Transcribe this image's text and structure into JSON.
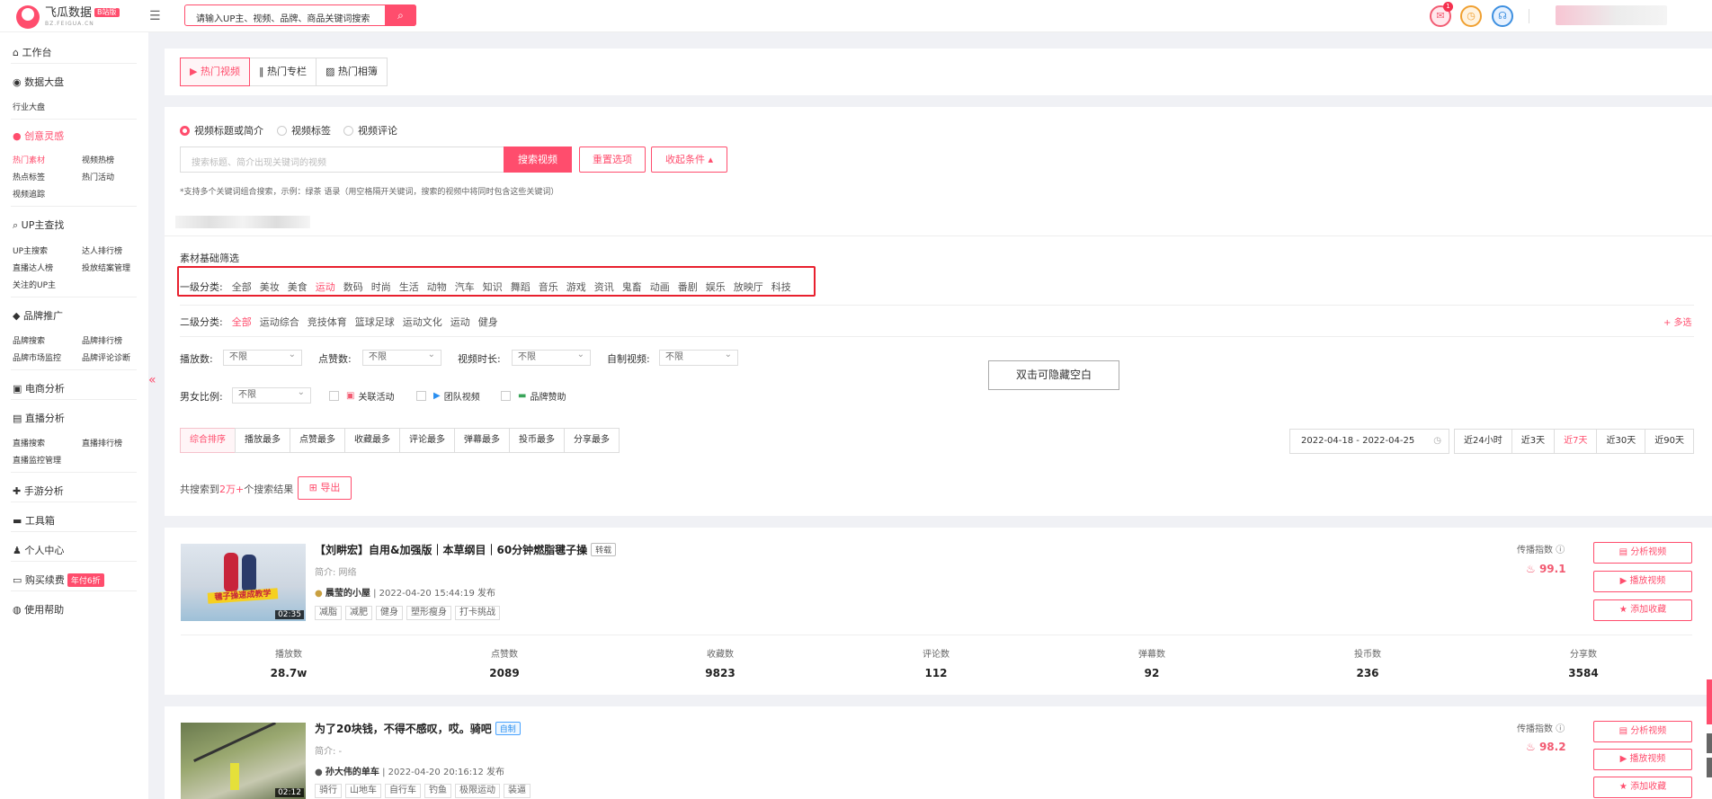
{
  "header": {
    "logo_name": "飞瓜数据",
    "logo_badge": "B站版",
    "logo_sub": "BZ.FEIGUA.CN",
    "search_placeholder": "请输入UP主、视频、品牌、商品关键词搜索",
    "notif_count": "1",
    "accent": "#ff4d6d"
  },
  "sidebar": {
    "workbench": "工作台",
    "data_screen": "数据大盘",
    "industry": "行业大盘",
    "creative": "创意灵感",
    "creative_subs": [
      "热门素材",
      "视频热榜",
      "热点标签",
      "热门活动",
      "视频追踪"
    ],
    "up_search": "UP主查找",
    "up_subs": [
      "UP主搜索",
      "达人排行榜",
      "直播达人榜",
      "投放结案管理",
      "关注的UP主"
    ],
    "brand": "品牌推广",
    "brand_subs": [
      "品牌搜索",
      "品牌排行榜",
      "品牌市场监控",
      "品牌评论诊断"
    ],
    "ecommerce": "电商分析",
    "live": "直播分析",
    "live_subs": [
      "直播搜索",
      "直播排行榜",
      "直播监控管理"
    ],
    "game": "手游分析",
    "toolbox": "工具箱",
    "personal": "个人中心",
    "renew": "购买续费",
    "renew_tag": "年付6折",
    "help": "使用帮助"
  },
  "tabs": [
    "热门视频",
    "热门专栏",
    "热门相簿"
  ],
  "search_scope": [
    "视频标题或简介",
    "视频标签",
    "视频评论"
  ],
  "keyword_placeholder": "搜索标题、简介出现关键词的视频",
  "buttons": {
    "search": "搜索视频",
    "reset": "重置选项",
    "collapse": "收起条件 ▴",
    "export": "导出",
    "more": "+ 多选"
  },
  "hint": "*支持多个关键词组合搜索，示例：绿茶 语录（用空格隔开关键词，搜索的视频中将同时包含这些关键词）",
  "filter_title": "素材基础筛选",
  "level1_label": "一级分类:",
  "level1": [
    "全部",
    "美妆",
    "美食",
    "运动",
    "数码",
    "时尚",
    "生活",
    "动物",
    "汽车",
    "知识",
    "舞蹈",
    "音乐",
    "游戏",
    "资讯",
    "鬼畜",
    "动画",
    "番剧",
    "娱乐",
    "放映厅",
    "科技"
  ],
  "level2_label": "二级分类:",
  "level2": [
    "全部",
    "运动综合",
    "竞技体育",
    "篮球足球",
    "运动文化",
    "运动",
    "健身"
  ],
  "filters": [
    {
      "label": "播放数:",
      "value": "不限"
    },
    {
      "label": "点赞数:",
      "value": "不限"
    },
    {
      "label": "视频时长:",
      "value": "不限"
    },
    {
      "label": "自制视频:",
      "value": "不限"
    }
  ],
  "gender_label": "男女比例:",
  "gender_value": "不限",
  "checks": [
    "关联活动",
    "团队视频",
    "品牌赞助"
  ],
  "tooltip": "双击可隐藏空白",
  "sort": [
    "综合排序",
    "播放最多",
    "点赞最多",
    "收藏最多",
    "评论最多",
    "弹幕最多",
    "投币最多",
    "分享最多"
  ],
  "date_range": "2022-04-18 - 2022-04-25",
  "ranges": [
    "近24小时",
    "近3天",
    "近7天",
    "近30天",
    "近90天"
  ],
  "result_prefix": "共搜索到",
  "result_count": "2万+",
  "result_suffix": "个搜索结果",
  "videos": [
    {
      "title": "【刘畊宏】自用&加强版｜本草纲目｜60分钟燃脂毽子操",
      "tag": "转载",
      "desc": "简介: 网络",
      "up": "晨莹的小屋",
      "time": "| 2022-04-20 15:44:19 发布",
      "tags": [
        "减脂",
        "减肥",
        "健身",
        "塑形瘦身",
        "打卡挑战"
      ],
      "duration": "02:35",
      "thumb_caption": "毽子操速成教学",
      "index_label": "传播指数",
      "index": "99.1",
      "actions": [
        "分析视频",
        "播放视频",
        "添加收藏"
      ],
      "stats": [
        {
          "l": "播放数",
          "v": "28.7w"
        },
        {
          "l": "点赞数",
          "v": "2089"
        },
        {
          "l": "收藏数",
          "v": "9823"
        },
        {
          "l": "评论数",
          "v": "112"
        },
        {
          "l": "弹幕数",
          "v": "92"
        },
        {
          "l": "投币数",
          "v": "236"
        },
        {
          "l": "分享数",
          "v": "3584"
        }
      ]
    },
    {
      "title": "为了20块钱，不得不感叹，哎。骑吧",
      "tag": "自制",
      "desc": "简介: -",
      "up": "孙大伟的单车",
      "time": "| 2022-04-20 20:16:12 发布",
      "tags": [
        "骑行",
        "山地车",
        "自行车",
        "钓鱼",
        "极限运动",
        "装逼"
      ],
      "duration": "02:12",
      "index_label": "传播指数",
      "index": "98.2",
      "actions": [
        "分析视频",
        "播放视频",
        "添加收藏"
      ]
    }
  ]
}
